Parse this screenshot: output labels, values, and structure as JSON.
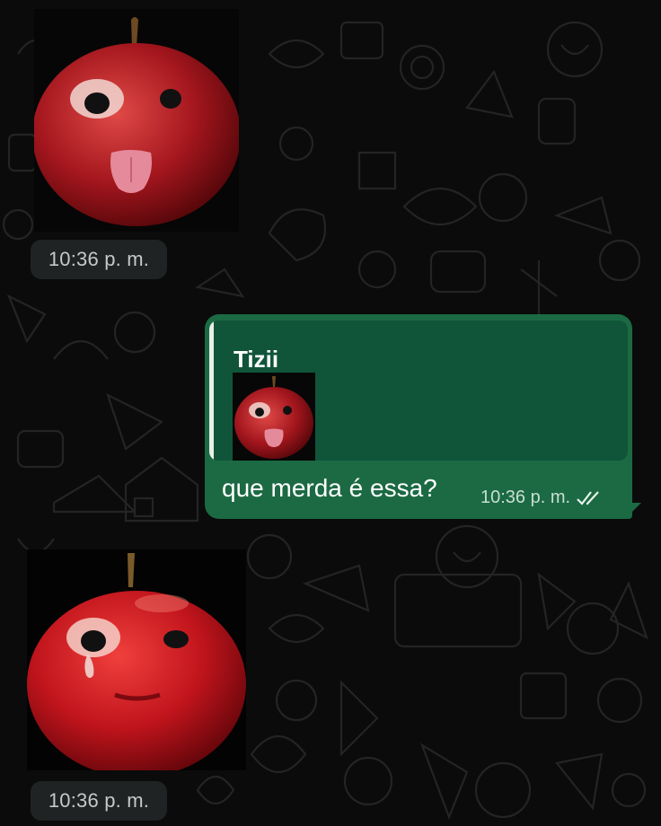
{
  "messages": [
    {
      "type": "incoming-image",
      "image": "apple-with-face-sticking-out-tongue",
      "time": "10:36 p. m."
    },
    {
      "type": "outgoing-text",
      "reply_to": {
        "author": "Tizii",
        "thumbnail": "apple-with-face-sticking-out-tongue"
      },
      "text": "que merda é essa?",
      "time": "10:36 p. m.",
      "status_icon": "double-check-read-icon"
    },
    {
      "type": "incoming-image",
      "image": "apple-with-face-crying",
      "time": "10:36 p. m."
    }
  ],
  "colors": {
    "background": "#0b0b0b",
    "outgoing_bubble": "#1b6a43",
    "quote_box": "#10553a",
    "time_pill": "#1f2323"
  }
}
